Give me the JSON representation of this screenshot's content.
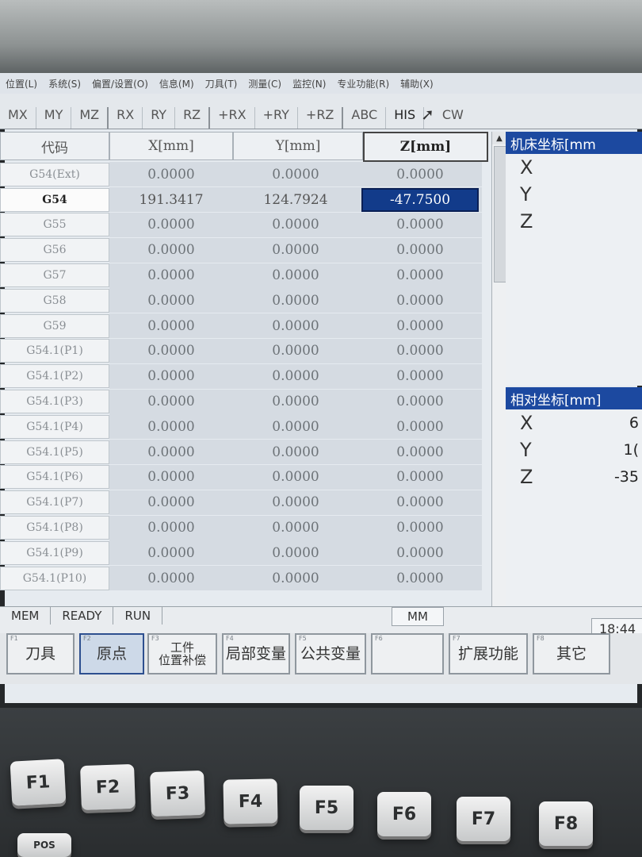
{
  "menu": [
    "位置(L)",
    "系统(S)",
    "偏置/设置(O)",
    "信息(M)",
    "刀具(T)",
    "测量(C)",
    "监控(N)",
    "专业功能(R)",
    "辅助(X)"
  ],
  "axis_buttons": [
    "MX",
    "MY",
    "MZ",
    "RX",
    "RY",
    "RZ",
    "+RX",
    "+RY",
    "+RZ",
    "ABC",
    "HIS",
    "CW"
  ],
  "table": {
    "headers": {
      "code": "代码",
      "x": "X[mm]",
      "y": "Y[mm]",
      "z": "Z[mm]"
    },
    "rows": [
      {
        "code": "G54(Ext)",
        "x": "0.0000",
        "y": "0.0000",
        "z": "0.0000"
      },
      {
        "code": "G54",
        "x": "191.3417",
        "y": "124.7924",
        "z": "-47.7500"
      },
      {
        "code": "G55",
        "x": "0.0000",
        "y": "0.0000",
        "z": "0.0000"
      },
      {
        "code": "G56",
        "x": "0.0000",
        "y": "0.0000",
        "z": "0.0000"
      },
      {
        "code": "G57",
        "x": "0.0000",
        "y": "0.0000",
        "z": "0.0000"
      },
      {
        "code": "G58",
        "x": "0.0000",
        "y": "0.0000",
        "z": "0.0000"
      },
      {
        "code": "G59",
        "x": "0.0000",
        "y": "0.0000",
        "z": "0.0000"
      },
      {
        "code": "G54.1(P1)",
        "x": "0.0000",
        "y": "0.0000",
        "z": "0.0000"
      },
      {
        "code": "G54.1(P2)",
        "x": "0.0000",
        "y": "0.0000",
        "z": "0.0000"
      },
      {
        "code": "G54.1(P3)",
        "x": "0.0000",
        "y": "0.0000",
        "z": "0.0000"
      },
      {
        "code": "G54.1(P4)",
        "x": "0.0000",
        "y": "0.0000",
        "z": "0.0000"
      },
      {
        "code": "G54.1(P5)",
        "x": "0.0000",
        "y": "0.0000",
        "z": "0.0000"
      },
      {
        "code": "G54.1(P6)",
        "x": "0.0000",
        "y": "0.0000",
        "z": "0.0000"
      },
      {
        "code": "G54.1(P7)",
        "x": "0.0000",
        "y": "0.0000",
        "z": "0.0000"
      },
      {
        "code": "G54.1(P8)",
        "x": "0.0000",
        "y": "0.0000",
        "z": "0.0000"
      },
      {
        "code": "G54.1(P9)",
        "x": "0.0000",
        "y": "0.0000",
        "z": "0.0000"
      },
      {
        "code": "G54.1(P10)",
        "x": "0.0000",
        "y": "0.0000",
        "z": "0.0000"
      }
    ]
  },
  "machine_panel": {
    "title": "机床坐标[mm",
    "axes": [
      "X",
      "Y",
      "Z"
    ]
  },
  "relative_panel": {
    "title": "相对坐标[mm]",
    "axes": [
      {
        "name": "X",
        "value": "6"
      },
      {
        "name": "Y",
        "value": "1("
      },
      {
        "name": "Z",
        "value": "-35"
      }
    ]
  },
  "status": {
    "mode": "MEM",
    "ready": "READY",
    "run": "RUN",
    "unit": "MM",
    "time": "18:44"
  },
  "softkeys": [
    {
      "fn": "F1",
      "label": "刀具"
    },
    {
      "fn": "F2",
      "label": "原点"
    },
    {
      "fn": "F3",
      "label": "工件\n位置补偿"
    },
    {
      "fn": "F4",
      "label": "局部变量"
    },
    {
      "fn": "F5",
      "label": "公共变量"
    },
    {
      "fn": "F6",
      "label": ""
    },
    {
      "fn": "F7",
      "label": "扩展功能"
    },
    {
      "fn": "F8",
      "label": "其它"
    }
  ],
  "hardware_keys": [
    "F1",
    "F2",
    "F3",
    "F4",
    "F5",
    "F6",
    "F7",
    "F8"
  ],
  "hardware_pos_label": "POS"
}
